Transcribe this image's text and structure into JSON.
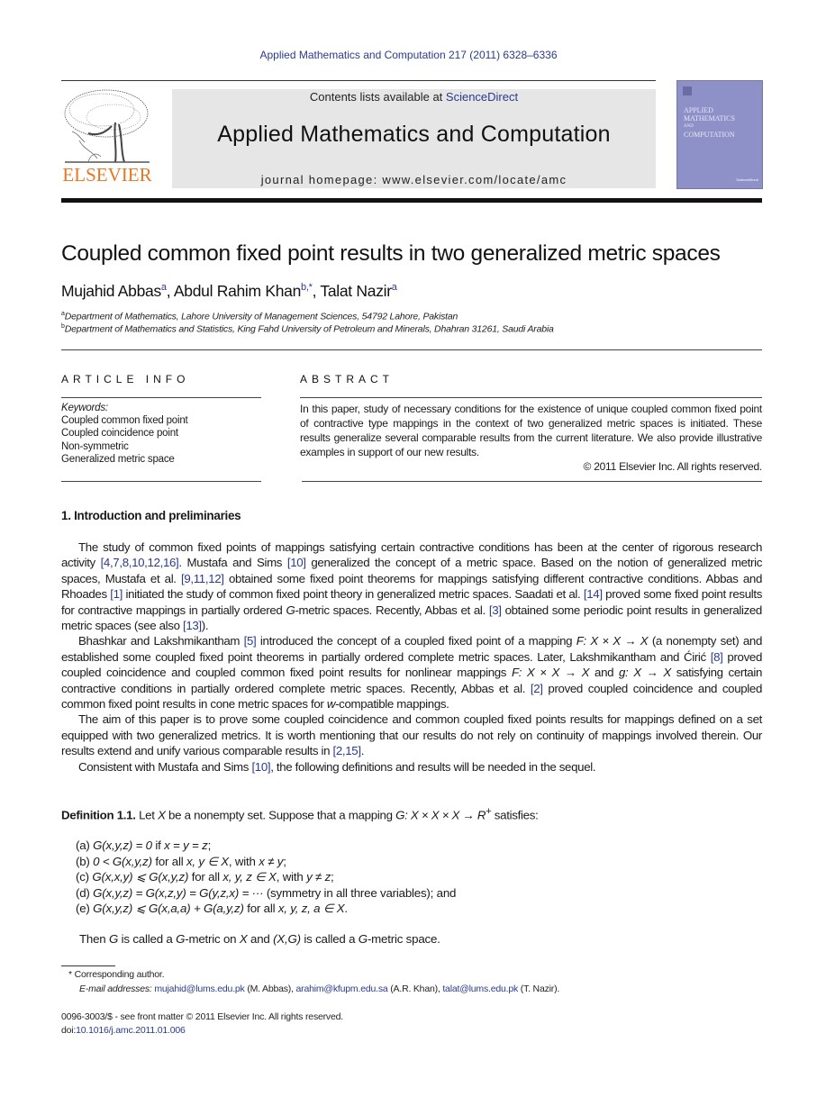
{
  "header": {
    "journal_ref": "Applied Mathematics and Computation 217 (2011) 6328–6336",
    "contents_prefix": "Contents lists available at ",
    "contents_link": "ScienceDirect",
    "journal_title": "Applied Mathematics and Computation",
    "homepage": "journal homepage: www.elsevier.com/locate/amc",
    "publisher_logo": "ELSEVIER",
    "cover": {
      "line1": "APPLIED",
      "line2": "MATHEMATICS",
      "line3": "AND",
      "line4": "COMPUTATION",
      "badge": "ScienceDirect"
    },
    "colors": {
      "link": "#2a3a8f",
      "elsevier_orange": "#e87722",
      "cover_bg": "#8e90c8",
      "banner_bg": "#e6e6e6"
    }
  },
  "article": {
    "title": "Coupled common fixed point results in two generalized metric spaces",
    "authors": [
      {
        "name": "Mujahid Abbas",
        "sup": "a"
      },
      {
        "name": "Abdul Rahim Khan",
        "sup": "b,*"
      },
      {
        "name": "Talat Nazir",
        "sup": "a"
      }
    ],
    "affiliations": [
      {
        "sup": "a",
        "text": "Department of Mathematics, Lahore University of Management Sciences, 54792 Lahore, Pakistan"
      },
      {
        "sup": "b",
        "text": "Department of Mathematics and Statistics, King Fahd University of Petroleum and Minerals, Dhahran 31261, Saudi Arabia"
      }
    ]
  },
  "article_info": {
    "heading": "ARTICLE INFO",
    "keywords_label": "Keywords:",
    "keywords": [
      "Coupled common fixed point",
      "Coupled coincidence point",
      "Non-symmetric",
      "Generalized metric space"
    ]
  },
  "abstract": {
    "heading": "ABSTRACT",
    "text": "In this paper, study of necessary conditions for the existence of unique coupled common fixed point of contractive type mappings in the context of two generalized metric spaces is initiated. These results generalize several comparable results from the current literature. We also provide illustrative examples in support of our new results.",
    "copyright": "© 2011 Elsevier Inc. All rights reserved."
  },
  "section1": {
    "heading": "1. Introduction and preliminaries",
    "p1": {
      "t1": "The study of common fixed points of mappings satisfying certain contractive conditions has been at the center of rigorous research activity ",
      "r1": "[4,7,8,10,12,16]",
      "t2": ". Mustafa and Sims ",
      "r2": "[10]",
      "t3": " generalized the concept of a metric space. Based on the notion of generalized metric spaces, Mustafa et al. ",
      "r3": "[9,11,12]",
      "t4": " obtained some fixed point theorems for mappings satisfying different contractive conditions. Abbas and Rhoades ",
      "r4": "[1]",
      "t5": " initiated the study of common fixed point theory in generalized metric spaces. Saadati et al. ",
      "r5": "[14]",
      "t6": " proved some fixed point results for contractive mappings in partially ordered ",
      "g": "G",
      "t7": "-metric spaces. Recently, Abbas et al. ",
      "r6": "[3]",
      "t8": " obtained some periodic point results in generalized metric spaces (see also ",
      "r7": "[13]",
      "t9": ")."
    },
    "p2": {
      "t1": "Bhashkar and Lakshmikantham ",
      "r1": "[5]",
      "t2": " introduced the concept of a coupled fixed point of a mapping ",
      "m1": "F: X × X → X",
      "t3": " (a nonempty set) and established some coupled fixed point theorems in partially ordered complete metric spaces. Later, Lakshmikantham and Ćirić ",
      "r2": "[8]",
      "t4": " proved coupled coincidence and coupled common fixed point results for nonlinear mappings ",
      "m2": "F: X × X → X",
      "t5": " and ",
      "m3": "g: X → X",
      "t6": " satisfying certain contractive conditions in partially ordered complete metric spaces. Recently, Abbas et al. ",
      "r3": "[2]",
      "t7": " proved coupled coincidence and coupled common fixed point results in cone metric spaces for ",
      "m4": "w",
      "t8": "-compatible mappings."
    },
    "p3": {
      "t1": "The aim of this paper is to prove some coupled coincidence and common coupled fixed points results for mappings defined on a set equipped with two generalized metrics. It is worth mentioning that our results do not rely on continuity of mappings involved therein. Our results extend and unify various comparable results in ",
      "r1": "[2,15]",
      "t2": "."
    },
    "p4": {
      "t1": "Consistent with Mustafa and Sims ",
      "r1": "[10]",
      "t2": ", the following definitions and results will be needed in the sequel."
    }
  },
  "definition": {
    "label": "Definition 1.1.",
    "t1": " Let ",
    "m1": "X",
    "t2": " be a nonempty set. Suppose that a mapping ",
    "m2": "G: X × X × X → R",
    "sup": "+",
    "t3": " satisfies:",
    "conditions": [
      {
        "label": "(a)",
        "math": "G(x,y,z) = 0",
        "text": " if ",
        "math2": "x = y = z",
        "tail": ";"
      },
      {
        "label": "(b)",
        "math": "0 < G(x,y,z)",
        "text": " for all ",
        "math2": "x, y ∈ X",
        "tail": ", with ",
        "math3": "x ≠ y",
        "end": ";"
      },
      {
        "label": "(c)",
        "math": "G(x,x,y) ⩽ G(x,y,z)",
        "text": " for all ",
        "math2": "x, y, z ∈ X",
        "tail": ", with ",
        "math3": "y ≠ z",
        "end": ";"
      },
      {
        "label": "(d)",
        "math": "G(x,y,z) = G(x,z,y) = G(y,z,x) = ···",
        "text": " (symmetry in all three variables); and",
        "math2": "",
        "tail": ""
      },
      {
        "label": "(e)",
        "math": "G(x,y,z) ⩽ G(x,a,a) + G(a,y,z)",
        "text": " for all ",
        "math2": "x, y, z, a ∈ X",
        "tail": "."
      }
    ],
    "then": {
      "t1": "Then ",
      "m1": "G",
      "t2": " is called a ",
      "m2": "G",
      "t3": "-metric on ",
      "m3": "X",
      "t4": " and ",
      "m4": "(X,G)",
      "t5": " is called a ",
      "m5": "G",
      "t6": "-metric space."
    }
  },
  "footnotes": {
    "corresponding_mark": "*",
    "corresponding": "Corresponding author.",
    "email_label": "E-mail addresses:",
    "emails": [
      {
        "addr": "mujahid@lums.edu.pk",
        "who": " (M. Abbas), "
      },
      {
        "addr": "arahim@kfupm.edu.sa",
        "who": " (A.R. Khan), "
      },
      {
        "addr": "talat@lums.edu.pk",
        "who": " (T. Nazir)."
      }
    ]
  },
  "imprint": {
    "issn_line": "0096-3003/$ - see front matter © 2011 Elsevier Inc. All rights reserved.",
    "doi_prefix": "doi:",
    "doi": "10.1016/j.amc.2011.01.006"
  }
}
